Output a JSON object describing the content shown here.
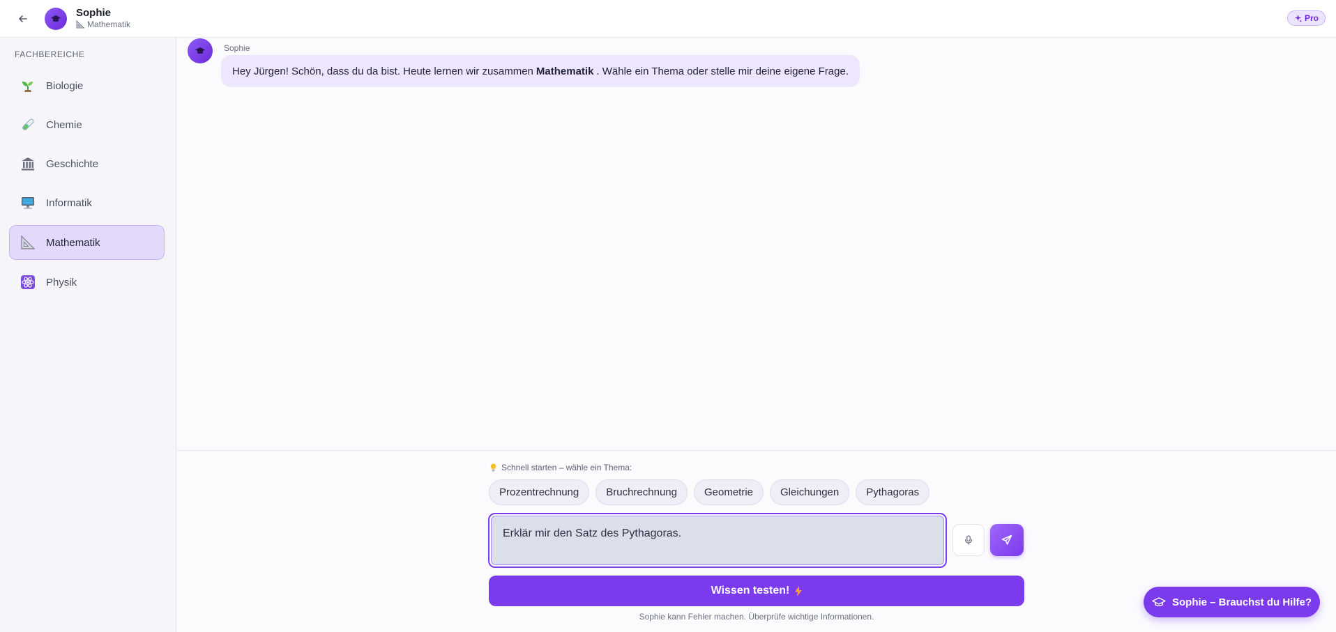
{
  "header": {
    "back_icon": "arrow-left-icon",
    "avatar_icon": "graduation-cap-icon",
    "name": "Sophie",
    "subject_icon": "triangle-ruler-icon",
    "subject": "Mathematik",
    "pro_label": "Pro"
  },
  "sidebar": {
    "heading": "FACHBEREICHE",
    "items": [
      {
        "label": "Biologie",
        "icon": "seedling-icon",
        "active": false
      },
      {
        "label": "Chemie",
        "icon": "test-tube-icon",
        "active": false
      },
      {
        "label": "Geschichte",
        "icon": "classical-building-icon",
        "active": false
      },
      {
        "label": "Informatik",
        "icon": "computer-icon",
        "active": false
      },
      {
        "label": "Mathematik",
        "icon": "triangle-ruler-icon",
        "active": true
      },
      {
        "label": "Physik",
        "icon": "atom-icon",
        "active": false
      }
    ]
  },
  "chat": {
    "author": "Sophie",
    "message_before": "Hey Jürgen! Schön, dass du da bist. Heute lernen wir zusammen",
    "message_bold": "Mathematik",
    "message_after": ". Wähle ein Thema oder stelle mir deine eigene Frage."
  },
  "composer": {
    "quick_start_label": "Schnell starten – wähle ein Thema:",
    "chips": [
      "Prozentrechnung",
      "Bruchrechnung",
      "Geometrie",
      "Gleichungen",
      "Pythagoras"
    ],
    "input_value": "Erklär mir den Satz des Pythagoras.",
    "test_button": "Wissen testen!",
    "disclaimer": "Sophie kann Fehler machen. Überprüfe wichtige Informationen."
  },
  "help_button": "Sophie – Brauchst du Hilfe?",
  "colors": {
    "accent": "#7c3aed",
    "active_bg": "#e3d9fb",
    "bubble_bg": "#ede6fc"
  }
}
